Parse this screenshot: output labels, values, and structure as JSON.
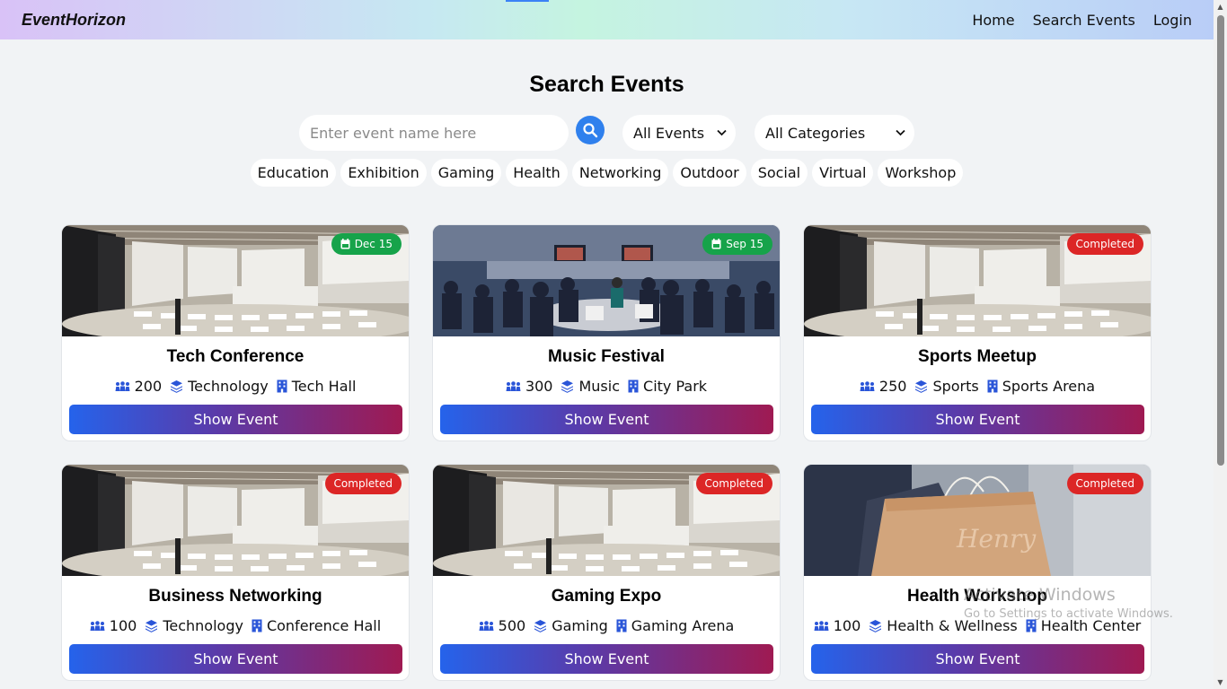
{
  "navbar": {
    "brand": "EventHorizon",
    "links": [
      "Home",
      "Search Events",
      "Login"
    ]
  },
  "page": {
    "title": "Search Events"
  },
  "search": {
    "placeholder": "Enter event name here",
    "status_filter": "All Events",
    "category_filter": "All Categories"
  },
  "categories": [
    "Education",
    "Exhibition",
    "Gaming",
    "Health",
    "Networking",
    "Outdoor",
    "Social",
    "Virtual",
    "Workshop"
  ],
  "events": [
    {
      "title": "Tech Conference",
      "badge": "Dec 15",
      "badge_type": "date",
      "attendees": "200",
      "category": "Technology",
      "venue": "Tech Hall",
      "button": "Show Event",
      "image": "conference-hall"
    },
    {
      "title": "Music Festival",
      "badge": "Sep 15",
      "badge_type": "date",
      "attendees": "300",
      "category": "Music",
      "venue": "City Park",
      "button": "Show Event",
      "image": "panel-audience"
    },
    {
      "title": "Sports Meetup",
      "badge": "Completed",
      "badge_type": "completed",
      "attendees": "250",
      "category": "Sports",
      "venue": "Sports Arena",
      "button": "Show Event",
      "image": "conference-hall"
    },
    {
      "title": "Business Networking",
      "badge": "Completed",
      "badge_type": "completed",
      "attendees": "100",
      "category": "Technology",
      "venue": "Conference Hall",
      "button": "Show Event",
      "image": "conference-hall"
    },
    {
      "title": "Gaming Expo",
      "badge": "Completed",
      "badge_type": "completed",
      "attendees": "500",
      "category": "Gaming",
      "venue": "Gaming Arena",
      "button": "Show Event",
      "image": "conference-hall"
    },
    {
      "title": "Health Workshop",
      "badge": "Completed",
      "badge_type": "completed",
      "attendees": "100",
      "category": "Health & Wellness",
      "venue": "Health Center",
      "button": "Show Event",
      "image": "shopping-bag"
    }
  ],
  "watermark": {
    "line1": "Activate Windows",
    "line2": "Go to Settings to activate Windows.",
    "bag_text": "Henry"
  },
  "colors": {
    "date_badge": "#16a34a",
    "completed_badge": "#dc2626",
    "search_button": "#2f80ed",
    "button_gradient_start": "#2563eb",
    "button_gradient_end": "#9f1a52"
  },
  "icons": {
    "search": "search-icon",
    "calendar": "calendar-icon",
    "attendees": "users-icon",
    "category": "layers-icon",
    "venue": "building-icon",
    "dropdown": "chevron-down-icon"
  }
}
